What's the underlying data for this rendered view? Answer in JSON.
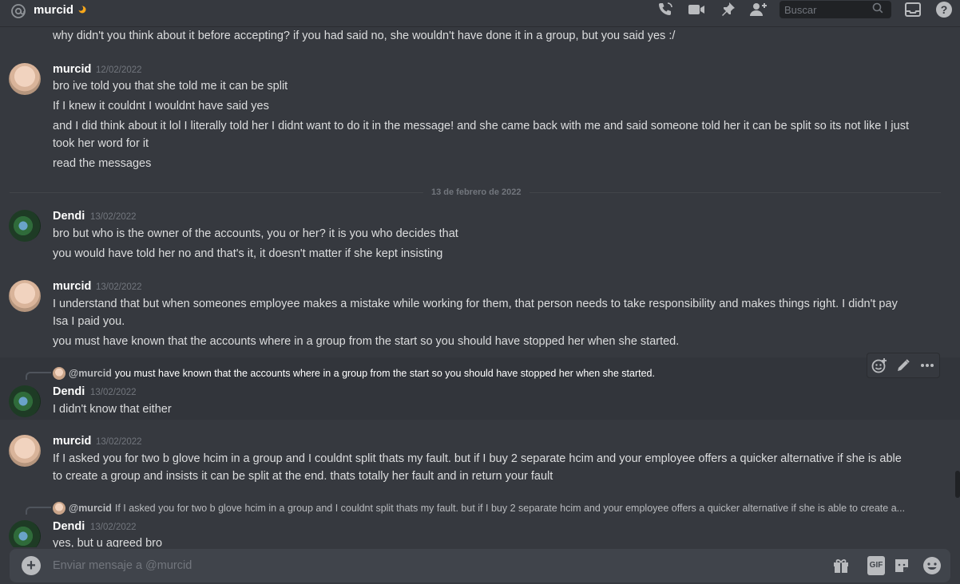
{
  "header": {
    "title": "murcid",
    "search_placeholder": "Buscar"
  },
  "divider_label": "13 de febrero de 2022",
  "messages": [
    {
      "text": "why didn't you think about it before accepting? if you had said no, she wouldn't have done it in a group, but you said yes :/"
    },
    {
      "user": "murcid",
      "time": "12/02/2022",
      "lines": [
        "bro ive told you that she told me it can be split",
        "If I knew it couldnt I wouldnt have said yes",
        "and I did think about it lol I literally told her I didnt want to do it in the message! and she came back with me and said someone told her it can be split so its not like I just",
        "took her word for it",
        "read the messages"
      ]
    },
    {
      "user": "Dendi",
      "time": "13/02/2022",
      "lines": [
        "bro but who is the owner of the accounts, you or her? it is you who decides that",
        "you would have told her no and that's it, it doesn't matter if she kept insisting"
      ]
    },
    {
      "user": "murcid",
      "time": "13/02/2022",
      "lines": [
        "I understand that but when someones employee makes a mistake while working for them, that person needs to take responsibility and makes things right. I didn't pay",
        "Isa I paid you.",
        "you must have known that the accounts where in a group from the start so you should have stopped her when she started."
      ]
    },
    {
      "reply_user": "@murcid",
      "reply_text": "you must have known that the accounts where in a group from the start so you should have stopped her when she started.",
      "user": "Dendi",
      "time": "13/02/2022",
      "lines": [
        "I didn't know that either"
      ]
    },
    {
      "user": "murcid",
      "time": "13/02/2022",
      "lines": [
        "If I asked you for two b glove hcim in a group and I couldnt split thats my fault. but if I buy 2 separate hcim and your employee offers a quicker alternative if she is able",
        "to create a group and insists it can be split at the end. thats totally her fault and in return your fault"
      ]
    },
    {
      "reply_user": "@murcid",
      "reply_text": "If I asked you for two b glove hcim in a group and I couldnt split thats my fault. but if I buy 2 separate hcim and your employee offers a quicker alternative if she is able to create a...",
      "user": "Dendi",
      "time": "13/02/2022",
      "lines": [
        "yes,  but u agreed bro"
      ]
    }
  ],
  "composer": {
    "placeholder": "Enviar mensaje a @murcid",
    "gif_label": "GIF"
  }
}
